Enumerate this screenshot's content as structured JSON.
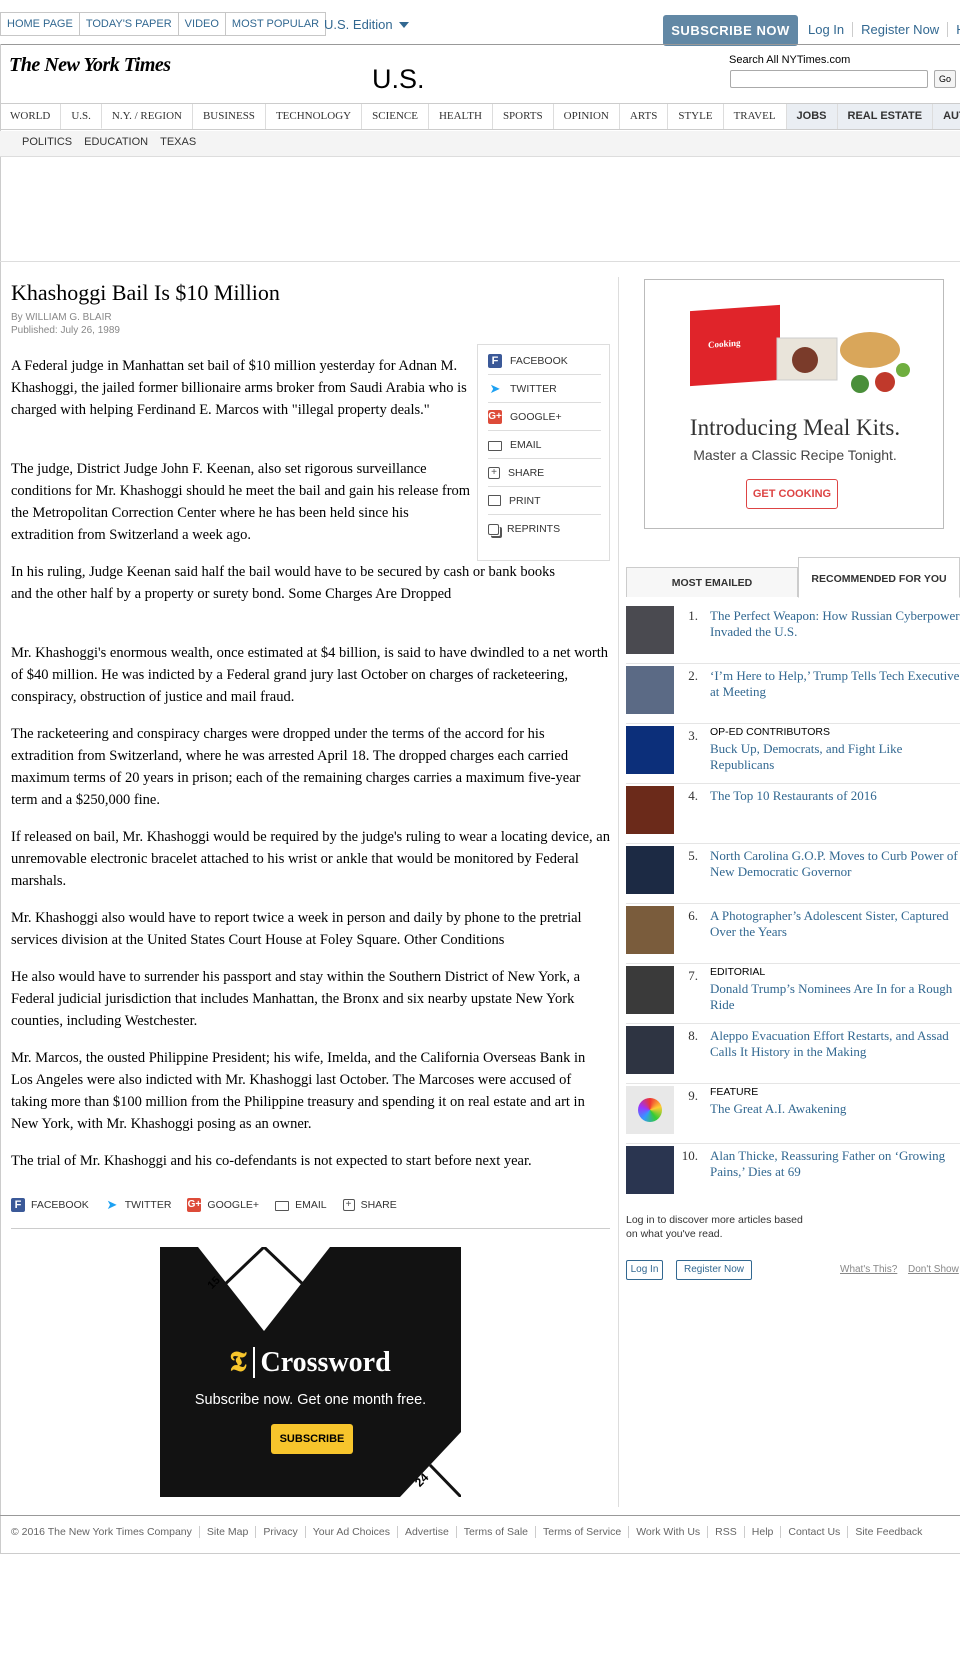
{
  "masthead": {
    "top_links": [
      "Home Page",
      "Today's Paper",
      "Video",
      "Most Popular"
    ],
    "edition": "U.S. Edition",
    "subscribe_label": "SUBSCRIBE NOW",
    "login_label": "Log In",
    "register_label": "Register Now",
    "help_label": "Help",
    "logo_text": "The New York Times",
    "section_title": "U.S.",
    "search_label": "Search All NYTimes.com",
    "search_go": "Go"
  },
  "nav": {
    "items": [
      "World",
      "U.S.",
      "N.Y. / Region",
      "Business",
      "Technology",
      "Science",
      "Health",
      "Sports",
      "Opinion",
      "Arts",
      "Style",
      "Travel"
    ],
    "classifieds": [
      "Jobs",
      "Real Estate",
      "Autos"
    ],
    "subitems": [
      "Politics",
      "Education",
      "Texas"
    ]
  },
  "article": {
    "headline": "Khashoggi Bail Is $10 Million",
    "byline_prefix": "By ",
    "author": "WILLIAM G. BLAIR",
    "published": "Published: July 26, 1989",
    "paragraphs": [
      "A Federal judge in Manhattan set bail of $10 million yesterday for Adnan M. Khashoggi, the jailed former billionaire arms broker from Saudi Arabia who is charged with helping Ferdinand E. Marcos with \"illegal property deals.\"",
      "The judge, District Judge John F. Keenan, also set rigorous surveillance conditions for Mr. Khashoggi should he meet the bail and gain his release from the Metropolitan Correction Center where he has been held since his extradition from Switzerland a week ago.",
      "In his ruling, Judge Keenan said half the bail would have to be secured by cash or bank books and the other half by a property or surety bond. Some Charges Are Dropped",
      "Mr. Khashoggi's enormous wealth, once estimated at $4 billion, is said to have dwindled to a net worth of $40 million. He was indicted by a Federal grand jury last October on charges of racketeering, conspiracy, obstruction of justice and mail fraud.",
      "The racketeering and conspiracy charges were dropped under the terms of the accord for his extradition from Switzerland, where he was arrested April 18. The dropped charges each carried maximum terms of 20 years in prison; each of the remaining charges carries a maximum five-year term and a $250,000 fine.",
      "If released on bail, Mr. Khashoggi would be required by the judge's ruling to wear a locating device, an unremovable electronic bracelet attached to his wrist or ankle that would be monitored by Federal marshals.",
      "Mr. Khashoggi also would have to report twice a week in person and daily by phone to the pretrial services division at the United States Court House at Foley Square. Other Conditions",
      "He also would have to surrender his passport and stay within the Southern District of New York, a Federal judicial jurisdiction that includes Manhattan, the Bronx and six nearby upstate New York counties, including Westchester.",
      "Mr. Marcos, the ousted Philippine President; his wife, Imelda, and the California Overseas Bank in Los Angeles were also indicted with Mr. Khashoggi last October. The Marcoses were accused of taking more than $100 million from the Philippine treasury and spending it on real estate and art in New York, with Mr. Khashoggi posing as an owner.",
      "The trial of Mr. Khashoggi and his co-defendants is not expected to start before next year."
    ]
  },
  "share_tools": {
    "facebook": "Facebook",
    "twitter": "Twitter",
    "google": "Google+",
    "email": "Email",
    "share": "Share",
    "print": "Print",
    "reprints": "Reprints"
  },
  "ads": {
    "meal": {
      "box_label": "Cooking",
      "title": "Introducing Meal Kits.",
      "subtitle": "Master a Classic Recipe Tonight.",
      "button": "GET COOKING"
    },
    "crossword": {
      "grid_number_top": "15",
      "grid_number_bottom": "24",
      "logo": "Crossword",
      "text": "Subscribe now. Get one month free.",
      "button": "SUBSCRIBE"
    }
  },
  "recommendations": {
    "tab_most_emailed": "Most Emailed",
    "tab_recommended": "Recommended for You",
    "items": [
      {
        "num": "1.",
        "kicker": "",
        "title": "The Perfect Weapon: How Russian Cyberpower Invaded the U.S."
      },
      {
        "num": "2.",
        "kicker": "",
        "title": "‘I’m Here to Help,’ Trump Tells Tech Executives at Meeting"
      },
      {
        "num": "3.",
        "kicker": "Op-Ed Contributors",
        "title": "Buck Up, Democrats, and Fight Like Republicans"
      },
      {
        "num": "4.",
        "kicker": "",
        "title": "The Top 10 Restaurants of 2016"
      },
      {
        "num": "5.",
        "kicker": "",
        "title": "North Carolina G.O.P. Moves to Curb Power of New Democratic Governor"
      },
      {
        "num": "6.",
        "kicker": "",
        "title": "A Photographer’s Adolescent Sister, Captured Over the Years"
      },
      {
        "num": "7.",
        "kicker": "Editorial",
        "title": "Donald Trump’s Nominees Are In for a Rough Ride"
      },
      {
        "num": "8.",
        "kicker": "",
        "title": "Aleppo Evacuation Effort Restarts, and Assad Calls It History in the Making"
      },
      {
        "num": "9.",
        "kicker": "Feature",
        "title": "The Great A.I. Awakening"
      },
      {
        "num": "10.",
        "kicker": "",
        "title": "Alan Thicke, Reassuring Father on ‘Growing Pains,’ Dies at 69"
      }
    ],
    "login_note": "Log in to discover more articles based on what you've read.",
    "login_button": "Log In",
    "register_button": "Register Now",
    "whats_this": "What's This?",
    "dont_show": "Don't Show"
  },
  "footer": {
    "links": [
      "© 2016 The New York Times Company",
      "Site Map",
      "Privacy",
      "Your Ad Choices",
      "Advertise",
      "Terms of Sale",
      "Terms of Service",
      "Work With Us",
      "RSS",
      "Help",
      "Contact Us",
      "Site Feedback"
    ]
  }
}
